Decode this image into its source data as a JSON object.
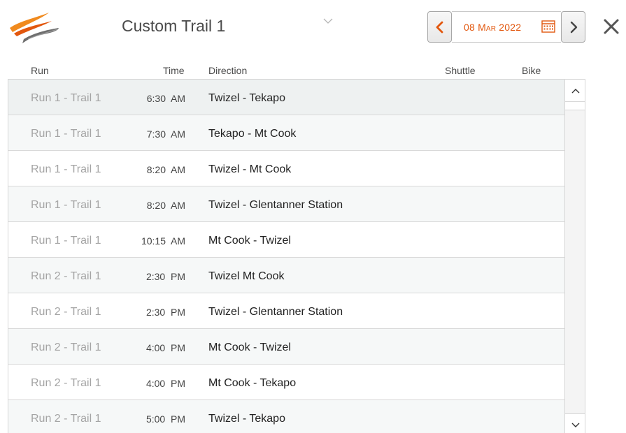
{
  "header": {
    "title": "Custom Trail 1",
    "date_prefix": "08 ",
    "date_month": "Mar",
    "date_suffix": " 2022",
    "accent_color": "#e2570e"
  },
  "icons": {
    "logo": "swoosh-logo",
    "title_dropdown": "chevron-down-icon",
    "prev": "chevron-left-icon",
    "next": "chevron-right-icon",
    "calendar": "calendar-icon",
    "close": "close-icon",
    "scroll_up": "chevron-up-icon",
    "scroll_down": "chevron-down-icon"
  },
  "columns": {
    "run": "Run",
    "time": "Time",
    "direction": "Direction",
    "shuttle": "Shuttle",
    "bike": "Bike"
  },
  "rows": [
    {
      "run": "Run 1 - Trail 1",
      "time": "6:30  AM",
      "direction": "Twizel - Tekapo",
      "shuttle": "",
      "bike": ""
    },
    {
      "run": "Run 1 - Trail 1",
      "time": "7:30  AM",
      "direction": "Tekapo - Mt Cook",
      "shuttle": "",
      "bike": ""
    },
    {
      "run": "Run 1 - Trail 1",
      "time": "8:20  AM",
      "direction": "Twizel - Mt Cook",
      "shuttle": "",
      "bike": ""
    },
    {
      "run": "Run 1 - Trail 1",
      "time": "8:20  AM",
      "direction": "Twizel - Glentanner Station",
      "shuttle": "",
      "bike": ""
    },
    {
      "run": "Run 1 - Trail 1",
      "time": "10:15  AM",
      "direction": "Mt Cook - Twizel",
      "shuttle": "",
      "bike": ""
    },
    {
      "run": "Run 2 - Trail 1",
      "time": "2:30  PM",
      "direction": "Twizel Mt Cook",
      "shuttle": "",
      "bike": ""
    },
    {
      "run": "Run 2 - Trail 1",
      "time": "2:30  PM",
      "direction": "Twizel - Glentanner Station",
      "shuttle": "",
      "bike": ""
    },
    {
      "run": "Run 2 - Trail 1",
      "time": "4:00  PM",
      "direction": "Mt Cook - Twizel",
      "shuttle": "",
      "bike": ""
    },
    {
      "run": "Run 2 - Trail 1",
      "time": "4:00  PM",
      "direction": "Mt Cook - Tekapo",
      "shuttle": "",
      "bike": ""
    },
    {
      "run": "Run 2 - Trail 1",
      "time": "5:00  PM",
      "direction": "Twizel - Tekapo",
      "shuttle": "",
      "bike": ""
    }
  ]
}
